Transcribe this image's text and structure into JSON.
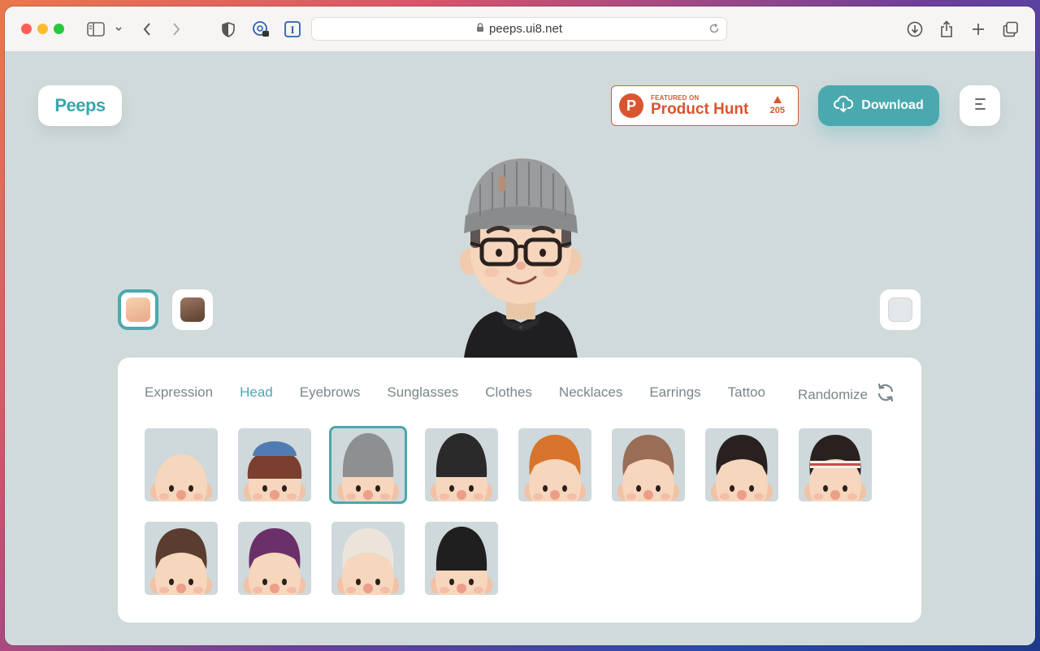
{
  "browser": {
    "url": "peeps.ui8.net",
    "icons": [
      "sidebar-icon",
      "chevron-down-icon",
      "back-icon",
      "forward-icon",
      "shield-icon",
      "password-icon",
      "instapaper-icon",
      "lock-icon",
      "reload-icon",
      "download-icon",
      "share-icon",
      "new-tab-icon",
      "tabs-icon"
    ]
  },
  "header": {
    "logo": "Peeps",
    "product_hunt": {
      "featured": "FEATURED ON",
      "name": "Product Hunt",
      "votes": "205",
      "letter": "P"
    },
    "download_label": "Download"
  },
  "colors": {
    "accent": "#4aa9ae",
    "product_hunt": "#da552f",
    "background": "#d1dadb"
  },
  "skin_swatches": [
    "light",
    "dark"
  ],
  "background_swatch": "neutral",
  "panel": {
    "tabs": [
      {
        "label": "Expression"
      },
      {
        "label": "Head"
      },
      {
        "label": "Eyebrows"
      },
      {
        "label": "Sunglasses"
      },
      {
        "label": "Clothes"
      },
      {
        "label": "Necklaces"
      },
      {
        "label": "Earrings"
      },
      {
        "label": "Tattoo"
      }
    ],
    "active_tab": "Head",
    "randomize_label": "Randomize",
    "head_options": [
      {
        "name": "bald",
        "hair": "#f2d7c0"
      },
      {
        "name": "blue-cap",
        "hair": "#7a3f2e"
      },
      {
        "name": "grey-beanie",
        "hair": "#8d8f90",
        "selected": true
      },
      {
        "name": "black-beanie",
        "hair": "#2a2a2a"
      },
      {
        "name": "ginger-hair",
        "hair": "#d8742c"
      },
      {
        "name": "brown-short",
        "hair": "#9a6d57"
      },
      {
        "name": "black-curly",
        "hair": "#2b2020"
      },
      {
        "name": "headband-curly",
        "hair": "#2b2020"
      },
      {
        "name": "brown-dreads",
        "hair": "#5a3c30"
      },
      {
        "name": "purple-hair",
        "hair": "#6b2f6a"
      },
      {
        "name": "blonde-hair",
        "hair": "#ece4da"
      },
      {
        "name": "black-cap-long",
        "hair": "#1f1f1f"
      }
    ]
  }
}
